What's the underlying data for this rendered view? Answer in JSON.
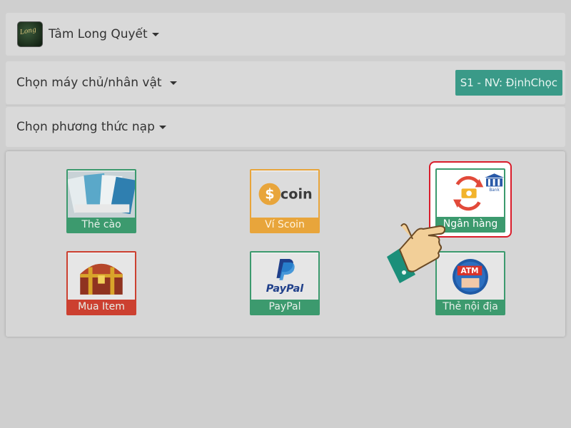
{
  "game": {
    "name": "Tâm Long Quyết"
  },
  "server": {
    "label": "Chọn máy chủ/nhân vật",
    "selected": "S1 - NV: ĐịnhChọc"
  },
  "method": {
    "label": "Chọn phương thức nạp"
  },
  "payment_methods": [
    {
      "label": "Thẻ cào",
      "icon": "card-stack-icon"
    },
    {
      "label": "Ví Scoin",
      "icon": "scoin-icon",
      "logo_text": "coin"
    },
    {
      "label": "Ngân hàng",
      "icon": "bank-transfer-icon",
      "logo_text": "Bank"
    },
    {
      "label": "Mua Item",
      "icon": "treasure-chest-icon"
    },
    {
      "label": "PayPal",
      "icon": "paypal-icon",
      "logo_text": "PayPal"
    },
    {
      "label": "Thẻ nội địa",
      "icon": "atm-card-icon",
      "logo_text": "ATM"
    }
  ],
  "colors": {
    "accent": "#3a9a88",
    "highlight": "#d91c2a",
    "green": "#3c9a6e",
    "orange": "#e8a53b",
    "red": "#cc4030"
  }
}
